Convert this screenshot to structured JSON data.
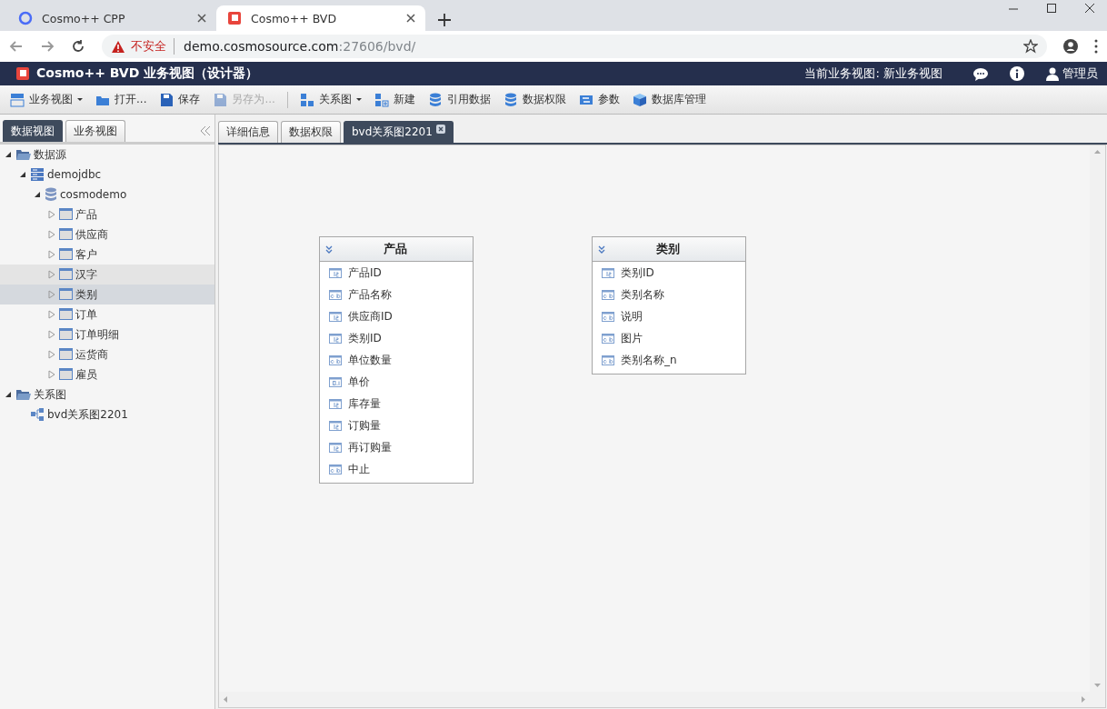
{
  "browser": {
    "tabs": [
      {
        "title": "Cosmo++ CPP",
        "selected": false
      },
      {
        "title": "Cosmo++ BVD",
        "selected": true
      }
    ],
    "address": {
      "warning": "不安全",
      "host": "demo.cosmosource.com",
      "path": ":27606/bvd/"
    }
  },
  "app_header": {
    "title": "Cosmo++ BVD 业务视图（设计器）",
    "current_view": "当前业务视图: 新业务视图",
    "user": "管理员"
  },
  "toolbar": {
    "groups": [
      [
        {
          "kind": "view",
          "label": "业务视图",
          "dropdown": true,
          "disabled": false
        },
        {
          "kind": "open",
          "label": "打开...",
          "dropdown": false,
          "disabled": false
        },
        {
          "kind": "save",
          "label": "保存",
          "dropdown": false,
          "disabled": false
        },
        {
          "kind": "save",
          "label": "另存为...",
          "dropdown": false,
          "disabled": true
        }
      ],
      [
        {
          "kind": "diagram",
          "label": "关系图",
          "dropdown": true,
          "disabled": false
        },
        {
          "kind": "new",
          "label": "新建",
          "dropdown": false,
          "disabled": false
        },
        {
          "kind": "database",
          "label": "引用数据",
          "dropdown": false,
          "disabled": false
        },
        {
          "kind": "database",
          "label": "数据权限",
          "dropdown": false,
          "disabled": false
        },
        {
          "kind": "params",
          "label": "参数",
          "dropdown": false,
          "disabled": false
        },
        {
          "kind": "cube",
          "label": "数据库管理",
          "dropdown": false,
          "disabled": false
        }
      ]
    ]
  },
  "sidebar": {
    "tabs": [
      {
        "label": "数据视图",
        "selected": true
      },
      {
        "label": "业务视图",
        "selected": false
      }
    ],
    "tree": [
      {
        "kind": "folder",
        "label": "数据源",
        "expanded": true,
        "selected": false,
        "hovered": false,
        "children": [
          {
            "kind": "server",
            "label": "demojdbc",
            "expanded": true,
            "selected": false,
            "hovered": false,
            "children": [
              {
                "kind": "database",
                "label": "cosmodemo",
                "expanded": true,
                "selected": false,
                "hovered": false,
                "children": [
                  {
                    "kind": "table",
                    "label": "产品",
                    "expanded": false,
                    "selected": false,
                    "hovered": false
                  },
                  {
                    "kind": "table",
                    "label": "供应商",
                    "expanded": false,
                    "selected": false,
                    "hovered": false
                  },
                  {
                    "kind": "table",
                    "label": "客户",
                    "expanded": false,
                    "selected": false,
                    "hovered": false
                  },
                  {
                    "kind": "table",
                    "label": "汉字",
                    "expanded": false,
                    "selected": false,
                    "hovered": true
                  },
                  {
                    "kind": "table",
                    "label": "类别",
                    "expanded": false,
                    "selected": true,
                    "hovered": false
                  },
                  {
                    "kind": "table",
                    "label": "订单",
                    "expanded": false,
                    "selected": false,
                    "hovered": false
                  },
                  {
                    "kind": "table",
                    "label": "订单明细",
                    "expanded": false,
                    "selected": false,
                    "hovered": false
                  },
                  {
                    "kind": "table",
                    "label": "运货商",
                    "expanded": false,
                    "selected": false,
                    "hovered": false
                  },
                  {
                    "kind": "table",
                    "label": "雇员",
                    "expanded": false,
                    "selected": false,
                    "hovered": false
                  }
                ]
              }
            ]
          }
        ]
      },
      {
        "kind": "folder",
        "label": "关系图",
        "expanded": true,
        "selected": false,
        "hovered": false,
        "children": [
          {
            "kind": "diagram",
            "label": "bvd关系图2201",
            "selected": false,
            "hovered": false
          }
        ]
      }
    ]
  },
  "workspace": {
    "tabs": [
      {
        "label": "详细信息",
        "selected": false,
        "closable": false
      },
      {
        "label": "数据权限",
        "selected": false,
        "closable": false
      },
      {
        "label": "bvd关系图2201",
        "selected": true,
        "closable": true
      }
    ],
    "entities": [
      {
        "title": "产品",
        "fields": [
          {
            "kind": "integer",
            "name": "产品ID"
          },
          {
            "kind": "text",
            "name": "产品名称"
          },
          {
            "kind": "integer",
            "name": "供应商ID"
          },
          {
            "kind": "integer",
            "name": "类别ID"
          },
          {
            "kind": "text",
            "name": "单位数量"
          },
          {
            "kind": "decimal",
            "name": "单价"
          },
          {
            "kind": "integer",
            "name": "库存量"
          },
          {
            "kind": "integer",
            "name": "订购量"
          },
          {
            "kind": "integer",
            "name": "再订购量"
          },
          {
            "kind": "text",
            "name": "中止"
          }
        ]
      },
      {
        "title": "类别",
        "fields": [
          {
            "kind": "integer",
            "name": "类别ID"
          },
          {
            "kind": "text",
            "name": "类别名称"
          },
          {
            "kind": "text",
            "name": "说明"
          },
          {
            "kind": "text",
            "name": "图片"
          },
          {
            "kind": "text",
            "name": "类别名称_n"
          }
        ]
      }
    ]
  }
}
